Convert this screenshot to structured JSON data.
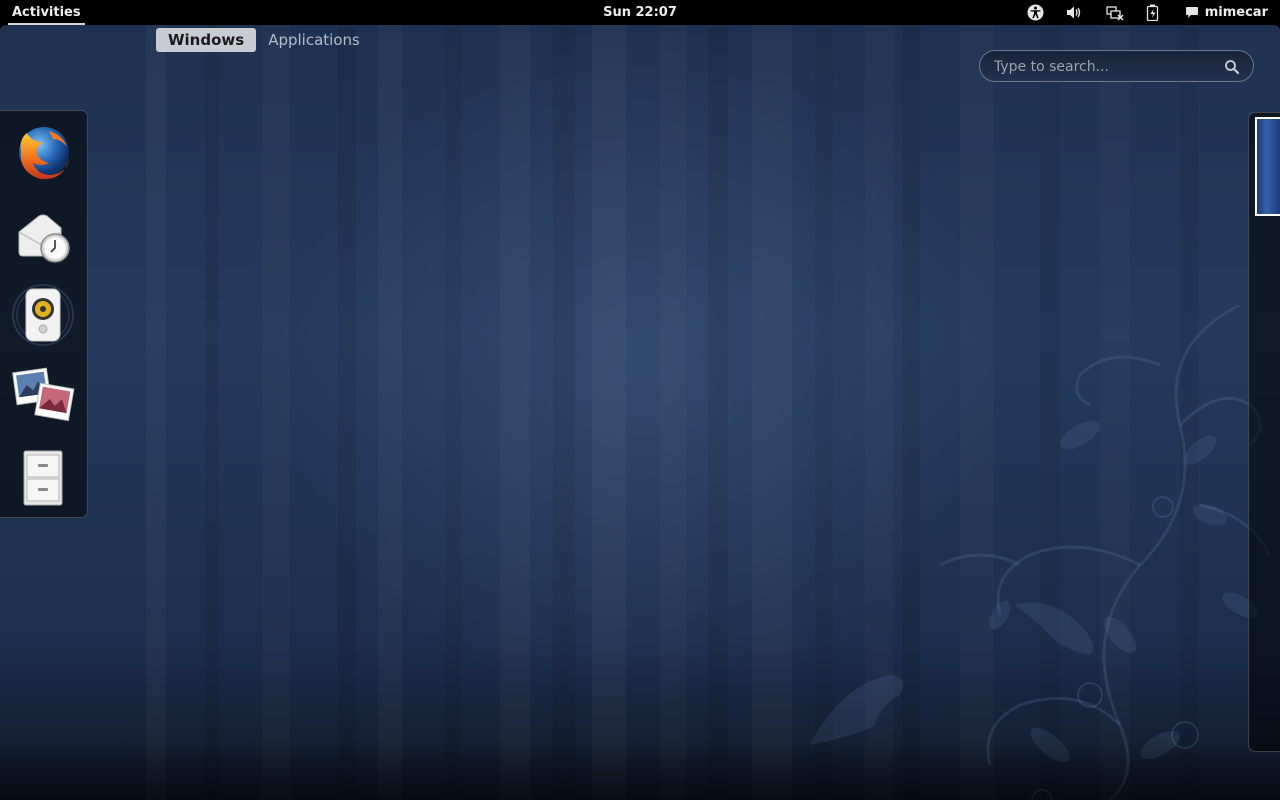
{
  "top_bar": {
    "activities_label": "Activities",
    "clock": "Sun 22:07",
    "status_icons": [
      "accessibility-icon",
      "volume-icon",
      "network-disconnected-icon",
      "battery-icon"
    ],
    "user_name": "mimecar",
    "user_icon": "chat-bubble-icon"
  },
  "view_selector": {
    "tabs": [
      {
        "label": "Windows",
        "active": true
      },
      {
        "label": "Applications",
        "active": false
      }
    ]
  },
  "search": {
    "placeholder": "Type to search...",
    "value": ""
  },
  "dash": {
    "items": [
      "firefox-icon",
      "evolution-mail-icon",
      "rhythmbox-icon",
      "shotwell-icon",
      "files-cabinet-icon"
    ]
  },
  "workspaces": {
    "count": 1,
    "active_index": 0
  },
  "colors": {
    "background_top": "#1f3150",
    "background_bottom": "#0e1727",
    "panel": "#000000",
    "active_tab": "#c8ccd2"
  }
}
